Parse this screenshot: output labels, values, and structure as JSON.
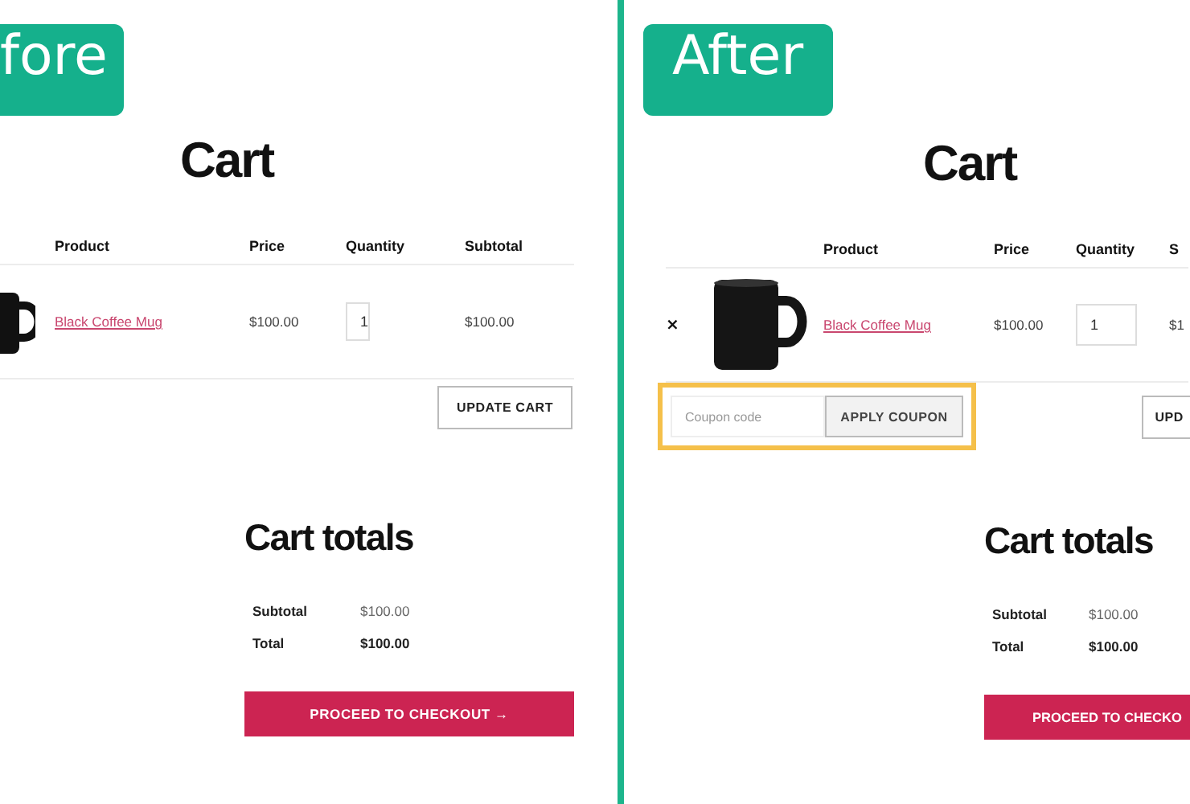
{
  "panels": [
    {
      "badge": "fore",
      "heading": "Cart",
      "columns": [
        "Product",
        "Price",
        "Quantity",
        "Subtotal"
      ],
      "rows": [
        {
          "product": "Black Coffee Mug",
          "price": "$100.00",
          "quantity": "1",
          "subtotal": "$100.00"
        }
      ],
      "update_button": "UPDATE CART",
      "totals_heading": "Cart totals",
      "totals": [
        {
          "kind": "subtotal",
          "label": "Subtotal",
          "value": "$100.00"
        },
        {
          "kind": "total",
          "label": "Total",
          "value": "$100.00"
        }
      ],
      "checkout_button": "PROCEED TO CHECKOUT →"
    },
    {
      "badge": "After",
      "heading": "Cart",
      "columns": [
        "Product",
        "Price",
        "Quantity",
        "S"
      ],
      "rows": [
        {
          "remove": "×",
          "product": "Black Coffee Mug",
          "price": "$100.00",
          "quantity": "1",
          "subtotal": "$1"
        }
      ],
      "coupon": {
        "placeholder": "Coupon code",
        "button": "APPLY COUPON",
        "highlighted": true
      },
      "update_button": "UPD",
      "totals_heading": "Cart totals",
      "totals": [
        {
          "kind": "subtotal",
          "label": "Subtotal",
          "value": "$100.00"
        },
        {
          "kind": "total",
          "label": "Total",
          "value": "$100.00"
        }
      ],
      "checkout_button": "PROCEED TO CHECKO"
    }
  ]
}
